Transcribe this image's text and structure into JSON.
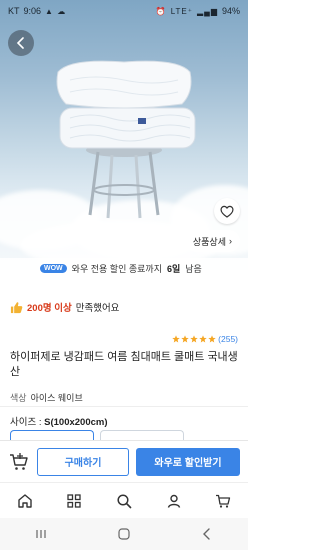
{
  "status_bar": {
    "carrier": "KT",
    "time": "9:06",
    "network": "LTE⁺",
    "battery": "94%"
  },
  "hero": {
    "detail_label": "상품상세",
    "slide_count": 5,
    "active_slide": 1
  },
  "promo": {
    "badge": "WOW",
    "text_prefix": "와우 전용 할인 종료까지",
    "days": "6일",
    "text_suffix": "남음"
  },
  "product": {
    "satisfaction_count": "200명 이상",
    "satisfaction_text": "만족했어요",
    "rating_stars": 5,
    "review_count": "(255)",
    "title": "하이퍼제로 냉감패드 여름 침대매트 쿨매트 국내생산",
    "color_label": "색상",
    "color_value": "아이스 웨이브",
    "size_label": "사이즈 :",
    "size_value": "S(100x200cm)"
  },
  "purchase_bar": {
    "buy_label": "구매하기",
    "wow_label": "와우로 할인받기"
  },
  "icons": {
    "back": "back-arrow-icon",
    "heart": "heart-icon",
    "cart": "cart-add-icon",
    "home": "home-icon",
    "category": "category-grid-icon",
    "search": "search-icon",
    "mypage": "person-icon",
    "cart_nav": "cart-icon"
  },
  "colors": {
    "accent": "#3a84e6",
    "satisfaction": "#d83a1a"
  }
}
